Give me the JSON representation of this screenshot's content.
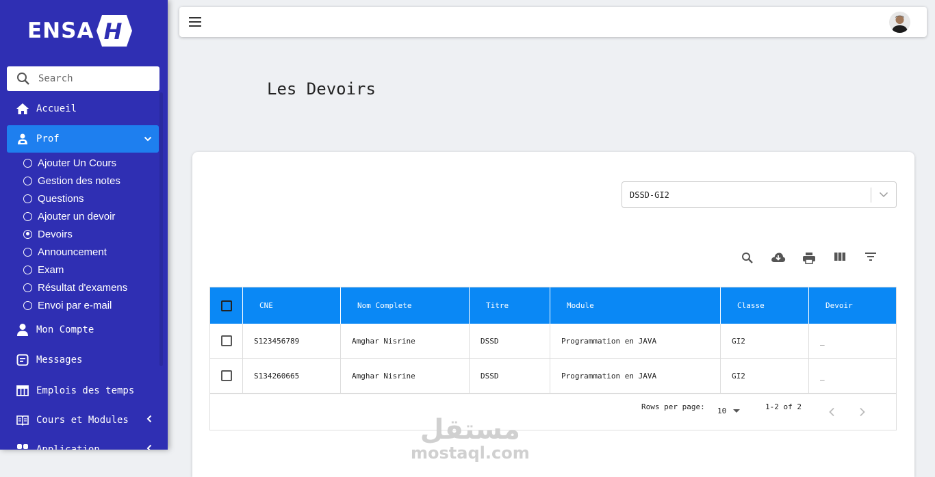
{
  "brand": {
    "logo_text": "ENSA",
    "logo_letter": "H"
  },
  "search": {
    "placeholder": "Search"
  },
  "sidebar": {
    "items": [
      {
        "label": "Accueil",
        "icon": "home-icon"
      },
      {
        "label": "Prof",
        "icon": "teacher-icon",
        "expanded": true
      },
      {
        "label": "Mon Compte",
        "icon": "user-icon"
      },
      {
        "label": "Messages",
        "icon": "message-icon"
      },
      {
        "label": "Emplois des temps",
        "icon": "calendar-table-icon"
      },
      {
        "label": "Cours et Modules",
        "icon": "book-icon"
      },
      {
        "label": "Application",
        "icon": "apps-icon"
      }
    ],
    "sub_items": [
      {
        "label": "Ajouter Un Cours",
        "selected": false
      },
      {
        "label": "Gestion des notes",
        "selected": false
      },
      {
        "label": "Questions",
        "selected": false
      },
      {
        "label": "Ajouter un devoir",
        "selected": false
      },
      {
        "label": "Devoirs",
        "selected": true
      },
      {
        "label": "Announcement",
        "selected": false
      },
      {
        "label": "Exam",
        "selected": false
      },
      {
        "label": "Résultat d'examens",
        "selected": false
      },
      {
        "label": "Envoi par e-mail",
        "selected": false
      }
    ]
  },
  "page": {
    "title": "Les Devoirs"
  },
  "filter": {
    "selected": "DSSD-GI2"
  },
  "toolbar": [
    "search-icon",
    "download-icon",
    "print-icon",
    "columns-icon",
    "filter-icon"
  ],
  "table": {
    "columns": [
      "CNE",
      "Nom Complete",
      "Titre",
      "Module",
      "Classe",
      "Devoir"
    ],
    "rows": [
      {
        "cne": "S123456789",
        "nom": "Amghar Nisrine",
        "titre": "DSSD",
        "module": "Programmation en JAVA",
        "classe": "GI2",
        "devoir": "_"
      },
      {
        "cne": "S134260665",
        "nom": "Amghar Nisrine",
        "titre": "DSSD",
        "module": "Programmation en JAVA",
        "classe": "GI2",
        "devoir": "_"
      }
    ],
    "pagination": {
      "rows_label": "Rows per page:",
      "rows_value": "10",
      "range": "1-2 of 2"
    }
  },
  "watermark": {
    "arabic": "مستقل",
    "latin": "mostaql.com"
  },
  "colors": {
    "sidebar": "#2f2fb3",
    "active": "#1e7fef",
    "table_header": "#0a88f5"
  }
}
